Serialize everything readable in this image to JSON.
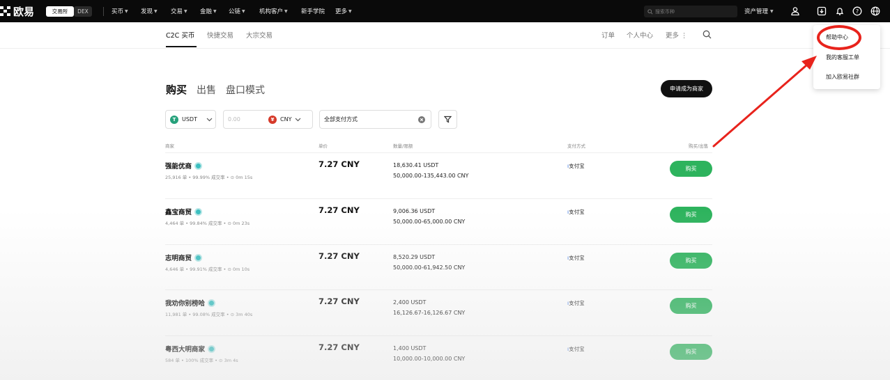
{
  "topbar": {
    "brand": "欧易",
    "pill_exchange": "交易所",
    "pill_dex": "DEX",
    "nav": [
      {
        "label": "买币"
      },
      {
        "label": "发现"
      },
      {
        "label": "交易"
      },
      {
        "label": "金融"
      },
      {
        "label": "公链"
      },
      {
        "label": "机构客户"
      },
      {
        "label": "新手学院"
      },
      {
        "label": "更多"
      }
    ],
    "search_placeholder": "搜索币种",
    "assets_label": "资产管理"
  },
  "subnav": {
    "tabs": [
      "C2C 买币",
      "快捷交易",
      "大宗交易"
    ],
    "right": [
      "订单",
      "个人中心",
      "更多"
    ]
  },
  "main": {
    "tab_buy": "购买",
    "tab_sell": "出售",
    "tab_book": "盘口模式",
    "merchant_button": "申请成为商家"
  },
  "filters": {
    "crypto": "USDT",
    "amount_placeholder": "0.00",
    "fiat": "CNY",
    "payment": "全部支付方式"
  },
  "columns": {
    "merchant": "商家",
    "price": "单价",
    "amount": "数量/限额",
    "payment": "支付方式",
    "action": "购买/出售"
  },
  "listings": [
    {
      "name": "强能优商",
      "stats": "25,916 单  •  99.99% 成交率  •  ⊙ 0m 15s",
      "price": "7.27 CNY",
      "quantity": "18,630.41 USDT",
      "limit": "50,000.00-135,443.00 CNY",
      "payment": "支付宝",
      "button": "购买"
    },
    {
      "name": "鑫宝商贸",
      "stats": "4,464 单  •  99.84% 成交率  •  ⊙ 0m 23s",
      "price": "7.27 CNY",
      "quantity": "9,006.36 USDT",
      "limit": "50,000.00-65,000.00 CNY",
      "payment": "支付宝",
      "button": "购买"
    },
    {
      "name": "志明商贸",
      "stats": "4,646 单  •  99.91% 成交率  •  ⊙ 0m 10s",
      "price": "7.27 CNY",
      "quantity": "8,520.29 USDT",
      "limit": "50,000.00-61,942.50 CNY",
      "payment": "支付宝",
      "button": "购买"
    },
    {
      "name": "我劝你别榜哈",
      "stats": "11,981 单  •  99.08% 成交率  •  ⊙ 3m 40s",
      "price": "7.27 CNY",
      "quantity": "2,400 USDT",
      "limit": "16,126.67-16,126.67 CNY",
      "payment": "支付宝",
      "button": "购买"
    },
    {
      "name": "粤西大明商家",
      "stats": "584 单  •  100% 成交率  •  ⊙ 3m 4s",
      "price": "7.27 CNY",
      "quantity": "1,400 USDT",
      "limit": "10,000.00-10,000.00 CNY",
      "payment": "支付宝",
      "button": "购买"
    }
  ],
  "help_menu": {
    "items": [
      "帮助中心",
      "我的客服工单",
      "加入欧易社群"
    ]
  },
  "colors": {
    "buy_green": "#2db35d",
    "annotation_red": "#e8231c",
    "usdt_teal": "#26a17b",
    "cny_red": "#d63a2a"
  }
}
